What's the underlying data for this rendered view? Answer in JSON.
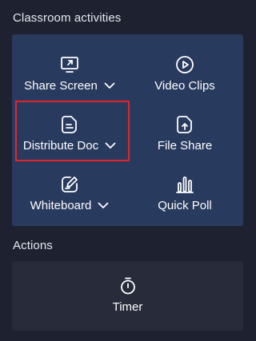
{
  "sections": {
    "activities_title": "Classroom activities",
    "actions_title": "Actions"
  },
  "activities": [
    {
      "label": "Share Screen",
      "icon": "share-screen-icon",
      "has_dropdown": true
    },
    {
      "label": "Video Clips",
      "icon": "video-clips-icon",
      "has_dropdown": false
    },
    {
      "label": "Distribute Doc",
      "icon": "document-icon",
      "has_dropdown": true,
      "highlighted": true
    },
    {
      "label": "File Share",
      "icon": "file-share-icon",
      "has_dropdown": false
    },
    {
      "label": "Whiteboard",
      "icon": "whiteboard-icon",
      "has_dropdown": true
    },
    {
      "label": "Quick Poll",
      "icon": "poll-icon",
      "has_dropdown": false
    }
  ],
  "actions": [
    {
      "label": "Timer",
      "icon": "timer-icon"
    }
  ],
  "colors": {
    "background": "#1e2230",
    "activities_panel": "#283a5e",
    "actions_panel": "#272b3a",
    "highlight_border": "#e0262b"
  }
}
